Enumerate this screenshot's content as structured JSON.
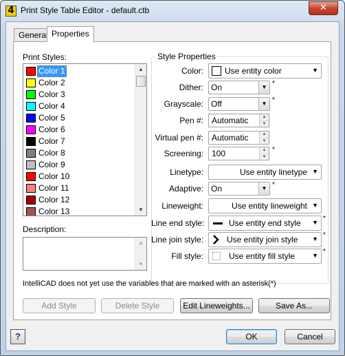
{
  "window": {
    "title": "Print Style Table Editor - default.ctb",
    "app_icon_glyph": "4",
    "close_glyph": "✕"
  },
  "tabs": [
    {
      "label": "General",
      "active": false
    },
    {
      "label": "Properties",
      "active": true
    }
  ],
  "print_styles": {
    "label": "Print Styles:",
    "selected_index": 0,
    "items": [
      {
        "label": "Color 1",
        "color": "#ff0000"
      },
      {
        "label": "Color 2",
        "color": "#ffff00"
      },
      {
        "label": "Color 3",
        "color": "#00ff00"
      },
      {
        "label": "Color 4",
        "color": "#00ffff"
      },
      {
        "label": "Color 5",
        "color": "#0000ff"
      },
      {
        "label": "Color 6",
        "color": "#ff00ff"
      },
      {
        "label": "Color 7",
        "color": "#000000"
      },
      {
        "label": "Color 8",
        "color": "#808080"
      },
      {
        "label": "Color 9",
        "color": "#c0c0c0"
      },
      {
        "label": "Color 10",
        "color": "#ff0000"
      },
      {
        "label": "Color 11",
        "color": "#ff7f7f"
      },
      {
        "label": "Color 12",
        "color": "#a50000"
      },
      {
        "label": "Color 13",
        "color": "#a55252"
      }
    ]
  },
  "description": {
    "label": "Description:",
    "value": ""
  },
  "style_properties": {
    "title": "Style Properties",
    "color": {
      "label": "Color:",
      "value": "Use entity color"
    },
    "dither": {
      "label": "Dither:",
      "value": "On",
      "asterisk": "*"
    },
    "grayscale": {
      "label": "Grayscale:",
      "value": "Off",
      "asterisk": "*"
    },
    "pen": {
      "label": "Pen #:",
      "value": "Automatic"
    },
    "virtual_pen": {
      "label": "Virtual pen #:",
      "value": "Automatic"
    },
    "screening": {
      "label": "Screening:",
      "value": "100",
      "asterisk": "*"
    },
    "linetype": {
      "label": "Linetype:",
      "value": "Use entity linetype"
    },
    "adaptive": {
      "label": "Adaptive:",
      "value": "On",
      "asterisk": "*"
    },
    "lineweight": {
      "label": "Lineweight:",
      "value": "Use entity lineweight"
    },
    "line_end": {
      "label": "Line end style:",
      "value": "Use entity end style",
      "asterisk": "*"
    },
    "line_join": {
      "label": "Line join style:",
      "value": "Use entity join style",
      "asterisk": "*"
    },
    "fill": {
      "label": "Fill style:",
      "value": "Use entity fill style",
      "asterisk": "*"
    }
  },
  "note": "IntelliCAD does not yet use the variables that are marked with an asterisk(*)",
  "buttons": {
    "add_style": "Add Style",
    "delete_style": "Delete Style",
    "edit_lineweights": "Edit Lineweights...",
    "save_as": "Save As...",
    "ok": "OK",
    "cancel": "Cancel",
    "help": "?"
  },
  "scroll": {
    "up_glyph": "▲",
    "down_glyph": "▼"
  },
  "combo_arrow": "▼",
  "spin": {
    "up_glyph": "▲",
    "down_glyph": "▼"
  }
}
